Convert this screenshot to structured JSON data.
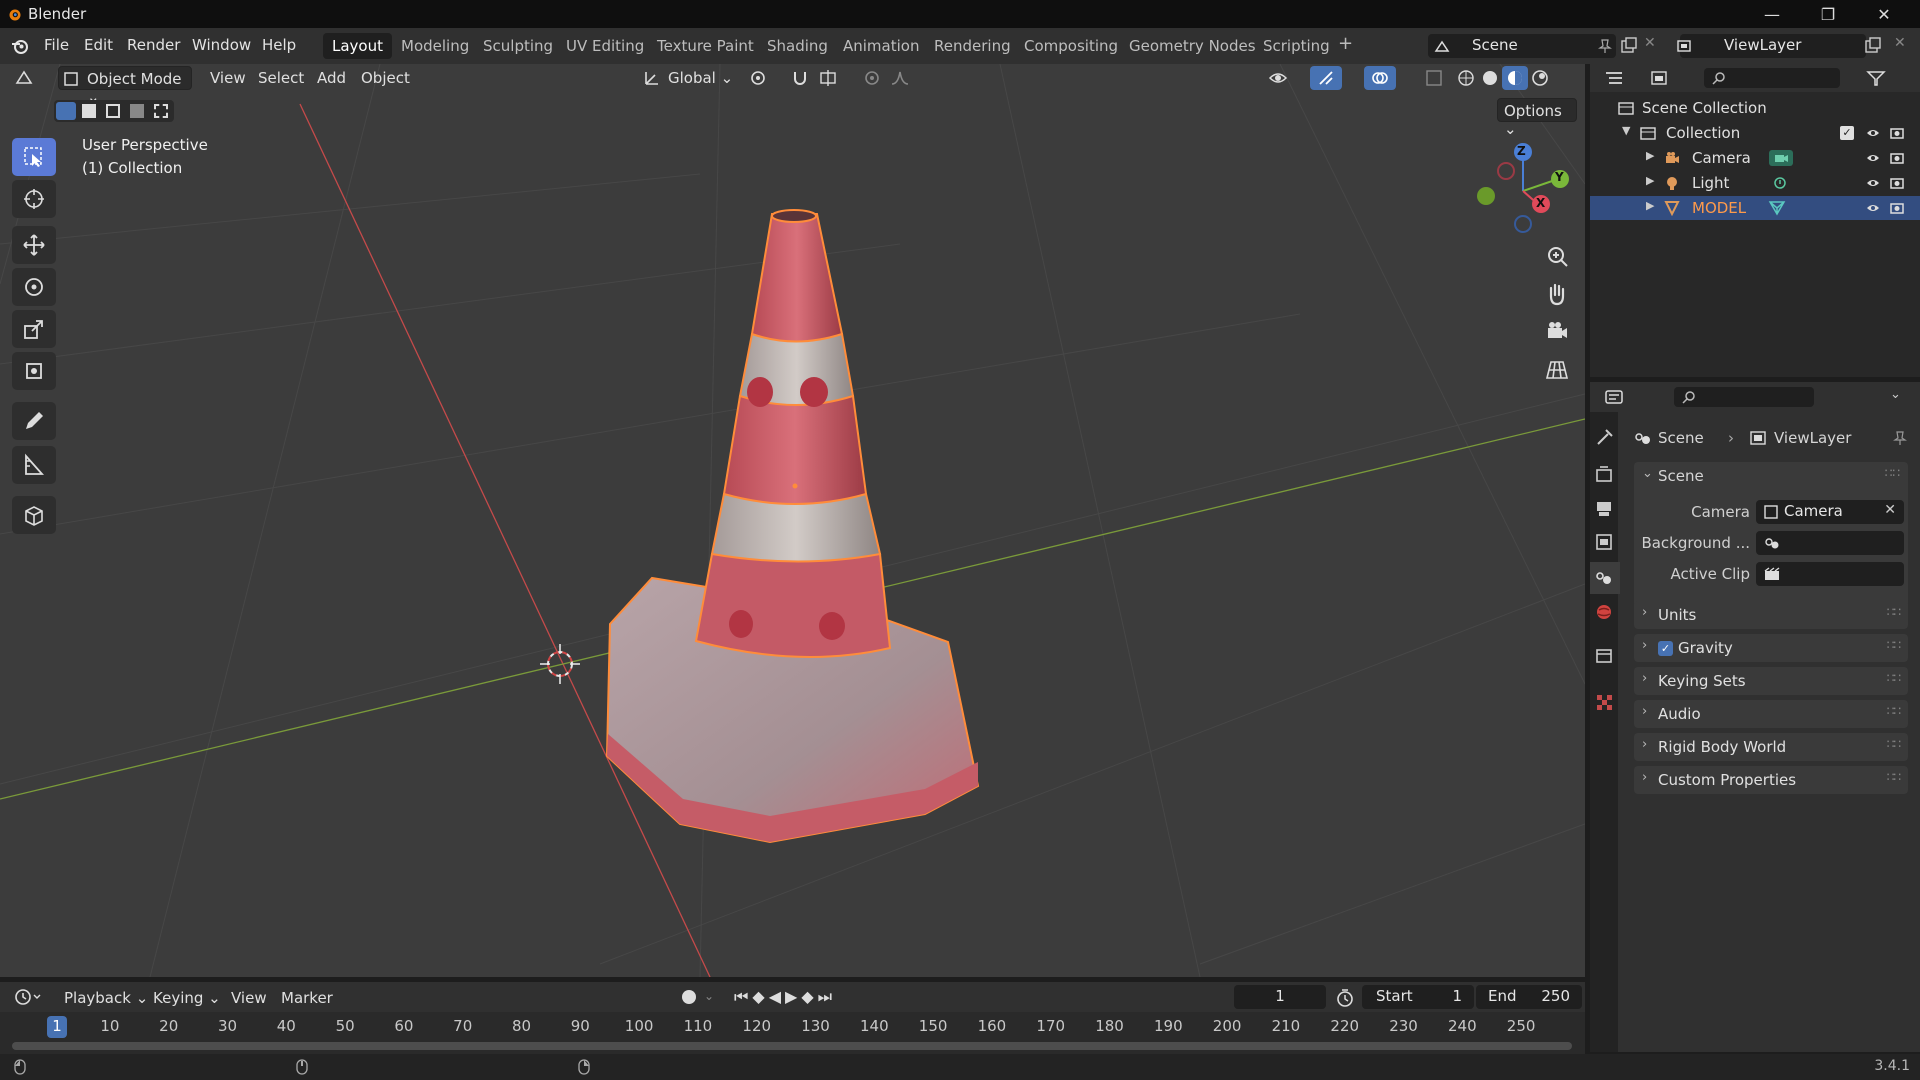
{
  "app": {
    "title": "Blender",
    "version": "3.4.1"
  },
  "menu": [
    "File",
    "Edit",
    "Render",
    "Window",
    "Help"
  ],
  "workspaces": [
    "Layout",
    "Modeling",
    "Sculpting",
    "UV Editing",
    "Texture Paint",
    "Shading",
    "Animation",
    "Rendering",
    "Compositing",
    "Geometry Nodes",
    "Scripting"
  ],
  "active_workspace": "Layout",
  "scene_name": "Scene",
  "view_layer_name": "ViewLayer",
  "viewport": {
    "mode": "Object Mode",
    "menus": [
      "View",
      "Select",
      "Add",
      "Object"
    ],
    "transform_orientation": "Global",
    "options_label": "Options",
    "perspective_label": "User Perspective",
    "collection_label": "(1) Collection",
    "gizmo": {
      "x": "X",
      "y": "Y",
      "z": "Z"
    }
  },
  "outliner": {
    "root": "Scene Collection",
    "collection": "Collection",
    "objects": [
      {
        "name": "Camera",
        "selected": false
      },
      {
        "name": "Light",
        "selected": false
      },
      {
        "name": "MODEL",
        "selected": true
      }
    ]
  },
  "properties": {
    "breadcrumb": [
      "Scene",
      "ViewLayer"
    ],
    "scene_panel": "Scene",
    "fields": [
      {
        "label": "Camera",
        "value": "Camera"
      },
      {
        "label": "Background ...",
        "value": ""
      },
      {
        "label": "Active Clip",
        "value": ""
      }
    ],
    "panels": [
      "Units",
      "Gravity",
      "Keying Sets",
      "Audio",
      "Rigid Body World",
      "Custom Properties"
    ],
    "gravity_enabled": true
  },
  "timeline": {
    "menus": [
      "Playback",
      "Keying",
      "View",
      "Marker"
    ],
    "current_frame": "1",
    "start_label": "Start",
    "start": "1",
    "end_label": "End",
    "end": "250",
    "ticks": [
      "1",
      "10",
      "20",
      "30",
      "40",
      "50",
      "60",
      "70",
      "80",
      "90",
      "100",
      "110",
      "120",
      "130",
      "140",
      "150",
      "160",
      "170",
      "180",
      "190",
      "200",
      "210",
      "220",
      "230",
      "240",
      "250"
    ]
  },
  "colors": {
    "accent": "#4772b3",
    "selected_object": "#ff8c3a",
    "viewport_bg": "#3c3c3c"
  }
}
